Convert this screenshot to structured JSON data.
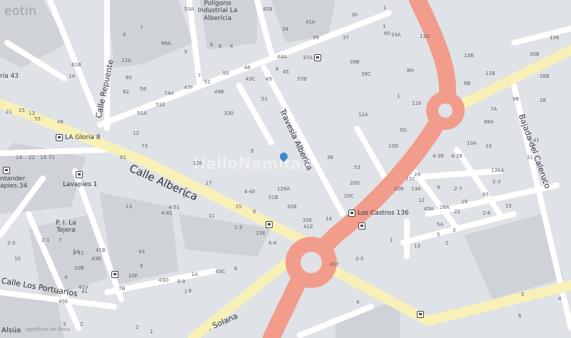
{
  "branding": {
    "logo_text": "eotin",
    "watermark": "HelloNamitas",
    "attribution": "ográficos de Ensa"
  },
  "streets": {
    "calle_alberica": "Calle Alberica",
    "travesia_alberica": "Travesía Alberica",
    "calle_repuente": "Calle Repuente",
    "bajada_caleruco": "Bajada del Caleruco",
    "calle_portuarios": "Calle Los Portuarios",
    "solana": ". Solana",
    "alsua": "Alsúa"
  },
  "places": {
    "poligono": "Polígono\nIndustrial La\nAlbericia",
    "pi_tejera": "P. I. La\nTejera",
    "ria43": "ría 43",
    "santander": "ntander\napies.34"
  },
  "bus_stops": [
    "LA Gloria 8",
    "Lavapies 1",
    "Los Castros 136"
  ],
  "numbers": [
    "53A",
    "45B",
    "30",
    "1",
    "9",
    "7",
    "66A",
    "5",
    "41A",
    "34",
    "33A",
    "39",
    "37",
    "60",
    "11D",
    "13B",
    "30B",
    "106",
    "12A",
    "8",
    "6",
    "4",
    "44A",
    "37A",
    "39B",
    "8H",
    "11B",
    "28B",
    "61B",
    "1A",
    "60",
    "46",
    "49",
    "45",
    "37B",
    "39C",
    "116",
    "6B",
    "1",
    "62",
    "56",
    "74A",
    "47F",
    "52",
    "50",
    "43C",
    "8",
    "51A",
    "51E",
    "49B",
    "51",
    "12A",
    "7A",
    "9B",
    "28",
    "21",
    "25",
    "13",
    "55",
    "46",
    "88A",
    "5D",
    "10D",
    "10A",
    "33",
    "4-39",
    "4-28",
    "31",
    "4-41",
    "1A",
    "22",
    "14",
    "12",
    "73",
    "71",
    "61",
    "38",
    "53",
    "29",
    "136A",
    "126",
    "17",
    "4-45",
    "51B",
    "32B",
    "20E",
    "20D",
    "20C",
    "20B",
    "132",
    "134",
    "9",
    "2-7",
    "2-3",
    "19",
    "65",
    "4-51",
    "13",
    "25",
    "8",
    "12",
    "45A",
    "26A",
    "22",
    "14",
    "2-6",
    "2-5",
    "15",
    "11",
    "1-3",
    "138",
    "4-4",
    "6",
    "4-61",
    "5A",
    "5",
    "3",
    "1",
    "13",
    "2",
    "2-3",
    "2-1",
    "7",
    "43",
    "2-11",
    "10",
    "1A",
    "10B",
    "41B",
    "6",
    "43B",
    "10F",
    "41",
    "4",
    "41V",
    "45E",
    "7B",
    "8",
    "6",
    "43C",
    "43D",
    "9-9",
    "1A",
    "1",
    "5",
    "4",
    "6",
    "3",
    "2",
    "2",
    "1",
    "7",
    "330",
    "9",
    "129A",
    "41Z",
    "41Y",
    "4",
    "1"
  ],
  "colors": {
    "background": "#dfe2e6",
    "highway": "#f29c8b",
    "major_road": "#f7f1b8",
    "block": "#cfd3d8",
    "road": "#ffffff"
  }
}
